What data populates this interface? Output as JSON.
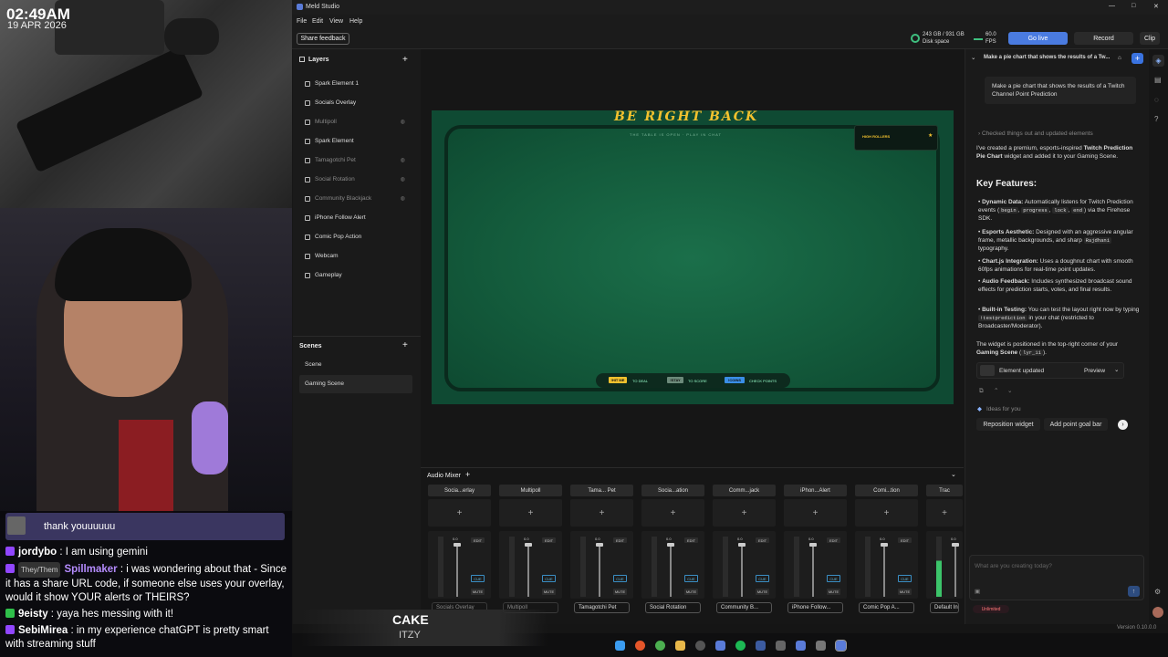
{
  "overlay": {
    "clock": "02:49AM",
    "date": "19 APR 2026"
  },
  "chat": {
    "banner": "thank youuuuuu",
    "lines": [
      {
        "user": "jordybo",
        "text": " : I am using gemini"
      },
      {
        "badge": "They/Them",
        "user": "Spillmaker",
        "text": " : i was wondering about that - Since it has a share URL code, if someone else uses your overlay, would it show YOUR alerts or THEIRS?"
      },
      {
        "user": "9eisty",
        "text": " : yaya hes messing with it!"
      },
      {
        "user": "SebiMirea",
        "text": " : in my experience chatGPT is pretty smart with streaming stuff"
      }
    ],
    "colors": {
      "jordybo": "#ffffff",
      "Spillmaker": "#b58cff",
      "9eisty": "#ffffff",
      "SebiMirea": "#ffffff"
    }
  },
  "now_playing": {
    "title": "CAKE",
    "artist": "ITZY"
  },
  "app": {
    "title": "Meld Studio",
    "menu": [
      "File",
      "Edit",
      "View",
      "Help"
    ],
    "share_feedback": "Share feedback",
    "disk": "243 GB / 931 GB",
    "disk_label": "Disk space",
    "fps_value": "60.0",
    "fps_label": "FPS",
    "go_live": "Go live",
    "record": "Record",
    "clip": "Clip",
    "version": "Version 0.10.0.0"
  },
  "layers": {
    "title": "Layers",
    "items": [
      {
        "label": "Spark Element 1",
        "dim": false
      },
      {
        "label": "Socials Overlay",
        "dim": false
      },
      {
        "label": "Multipoll",
        "dim": true
      },
      {
        "label": "Spark Element",
        "dim": false
      },
      {
        "label": "Tamagotchi Pet",
        "dim": true
      },
      {
        "label": "Social Rotation",
        "dim": true
      },
      {
        "label": "Community Blackjack",
        "dim": true
      },
      {
        "label": "iPhone Follow Alert",
        "dim": false
      },
      {
        "label": "Comic Pop Action",
        "dim": false
      },
      {
        "label": "Webcam",
        "dim": false
      },
      {
        "label": "Gameplay",
        "dim": false
      }
    ]
  },
  "scenes": {
    "title": "Scenes",
    "items": [
      "Scene",
      "Gaming Scene"
    ]
  },
  "preview": {
    "headline": "BE RIGHT BACK",
    "subline": "THE TABLE IS OPEN · PLAY IN CHAT",
    "box_label": "HIGH ROLLERS",
    "legend": [
      {
        "tag": "!HIT ME",
        "text": "TO DEAL",
        "color": "#f2c12e"
      },
      {
        "tag": "!STAY",
        "text": "TO SCORE",
        "color": "#6c8a7a"
      },
      {
        "tag": "!COINS",
        "text": "CHECK POINTS",
        "color": "#3a8ee6"
      }
    ]
  },
  "mixer": {
    "title": "Audio Mixer",
    "channels": [
      {
        "short": "Socia...erlay",
        "foot": "Socials Overlay",
        "value": "0.0",
        "active": false
      },
      {
        "short": "Multipoll",
        "foot": "Multipoll",
        "value": "0.0",
        "active": false
      },
      {
        "short": "Tama... Pet",
        "foot": "Tamagotchi Pet",
        "value": "0.0",
        "active": true
      },
      {
        "short": "Socia...ation",
        "foot": "Social Rotation",
        "value": "0.0",
        "active": true
      },
      {
        "short": "Comm...jack",
        "foot": "Community B...",
        "value": "0.0",
        "active": true
      },
      {
        "short": "iPhon...Alert",
        "foot": "iPhone Follow...",
        "value": "0.0",
        "active": true
      },
      {
        "short": "Comi...tion",
        "foot": "Comic Pop A...",
        "value": "0.0",
        "active": true
      },
      {
        "short": "Trac",
        "foot": "Default Inpu",
        "value": "0.0",
        "active": true
      }
    ],
    "edit": "EDIT",
    "cue": "CUE",
    "mute": "MUTE"
  },
  "ai": {
    "header": "Make a pie chart that shows the results of a Tw...",
    "prompt": "Make a pie chart that shows the results of a Twitch Channel Point Prediction",
    "checked": "Checked things out and updated elements",
    "intro_a": "I've created a premium, esports-inspired ",
    "intro_b": "Twitch Prediction Pie Chart",
    "intro_c": " widget and added it to your Gaming Scene.",
    "features_title": "Key Features:",
    "f1_t": "Dynamic Data:",
    "f1": " Automatically listens for Twitch Prediction events (",
    "f1_c1": "begin",
    "f1_c2": "progress",
    "f1_c3": "lock",
    "f1_c4": "end",
    "f1_end": ") via the Firehose SDK.",
    "f2_t": "Esports Aesthetic:",
    "f2": " Designed with an aggressive angular frame, metallic backgrounds, and sharp ",
    "f2_c": "Rajdhani",
    "f2_end": " typography.",
    "f3_t": "Chart.js Integration:",
    "f3": " Uses a doughnut chart with smooth 60fps animations for real-time point updates.",
    "f4_t": "Audio Feedback:",
    "f4": " Includes synthesized broadcast sound effects for prediction starts, votes, and final results.",
    "f5_t": "Built-in Testing:",
    "f5": " You can test the layout right now by typing ",
    "f5_c": "!testprediction",
    "f5_end": " in your chat (restricted to Broadcaster/Moderator).",
    "pos_a": "The widget is positioned in the top-right corner of your ",
    "pos_b": "Gaming Scene",
    "pos_c": " (",
    "pos_code": "lyr_11",
    "pos_d": ").",
    "element_updated": "Element updated",
    "preview": "Preview",
    "ideas": "Ideas for you",
    "idea1": "Reposition widget",
    "idea2": "Add point goal bar",
    "input_placeholder": "What are you creating today?",
    "plan": "Unlimited"
  }
}
